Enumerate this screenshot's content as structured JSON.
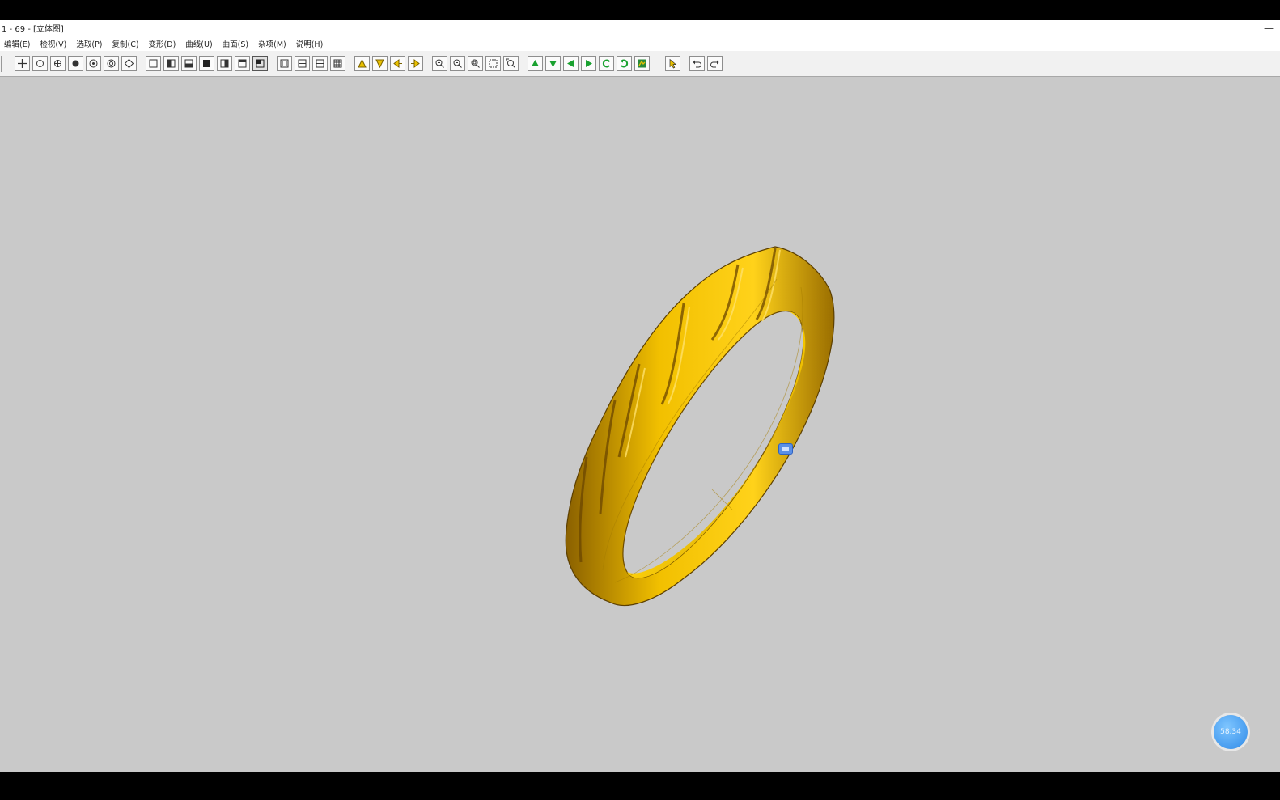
{
  "window": {
    "title": "1 - 69 - [立体图]",
    "minimize_glyph": "—"
  },
  "menu": [
    {
      "label": "编辑(E)"
    },
    {
      "label": "检视(V)"
    },
    {
      "label": "选取(P)"
    },
    {
      "label": "复制(C)"
    },
    {
      "label": "变形(D)"
    },
    {
      "label": "曲线(U)"
    },
    {
      "label": "曲面(S)"
    },
    {
      "label": "杂项(M)"
    },
    {
      "label": "说明(H)"
    }
  ],
  "toolbar": {
    "icons": [
      "crosshair-icon",
      "circle-icon",
      "point-icon",
      "solid-point-icon",
      "target-icon",
      "ring-point-icon",
      "diamond-icon",
      "square-icon",
      "half-left-icon",
      "half-bottom-icon",
      "fill-square-icon",
      "half-right-icon",
      "top-bar-icon",
      "selected-view-icon",
      "frame-icon",
      "split-vertical-icon",
      "split-grid-icon",
      "grid-icon",
      "triangle-up-icon",
      "triangle-down-icon",
      "arrow-left-yellow-icon",
      "arrow-right-yellow-icon",
      "zoom-in-icon",
      "zoom-out-icon",
      "zoom-window-icon",
      "zoom-box-icon",
      "zoom-all-icon",
      "green-up-icon",
      "green-down-icon",
      "green-left-icon",
      "green-right-icon",
      "rotate-left-icon",
      "rotate-right-icon",
      "render-icon",
      "pointer-icon",
      "undo-icon",
      "redo-icon"
    ],
    "pressed_index": 13
  },
  "viewport": {
    "background_color": "#c9c9c9",
    "model": {
      "name": "twisted-ring",
      "color": "#f0c000"
    }
  },
  "status": {
    "bubble_text": "58.34"
  }
}
